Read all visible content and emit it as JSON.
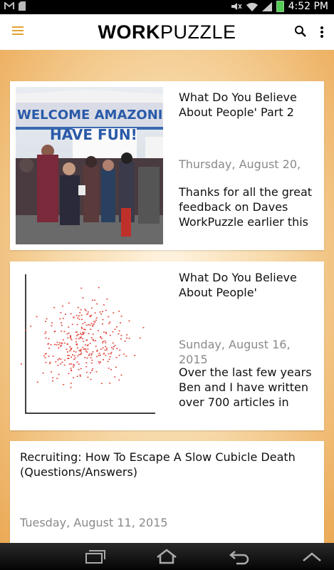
{
  "status_bar": {
    "time": "4:52 PM",
    "icons": [
      "gmail-icon",
      "sd-card-icon",
      "mute-icon",
      "wifi-icon",
      "signal-icon",
      "battery-icon"
    ]
  },
  "app_bar": {
    "logo_bold": "WORK",
    "logo_light": "PUZZLE",
    "accent_color": "#e3a232"
  },
  "posts": [
    {
      "title": "What Do You Believe About People' Part 2",
      "date": "Thursday, August 20,",
      "excerpt": "Thanks for all the great feedback on Daves WorkPuzzle earlier this",
      "image": "welcome-amazonians-photo",
      "image_text_line1": "WELCOME AMAZONIAN",
      "image_text_line2": "HAVE FUN!"
    },
    {
      "title": "What Do You Believe About People'",
      "date": "Sunday, August 16, 2015",
      "excerpt": "Over the last few years Ben and I have written over 700 articles in",
      "image": "scatter-plot-image"
    },
    {
      "title": "Recruiting: How To Escape A Slow Cubicle Death (Questions/Answers)",
      "date": "Tuesday, August 11, 2015"
    }
  ],
  "nav_bar": {
    "icons": [
      "recent-apps-icon",
      "home-icon",
      "back-icon",
      "up-arrow-icon"
    ]
  }
}
